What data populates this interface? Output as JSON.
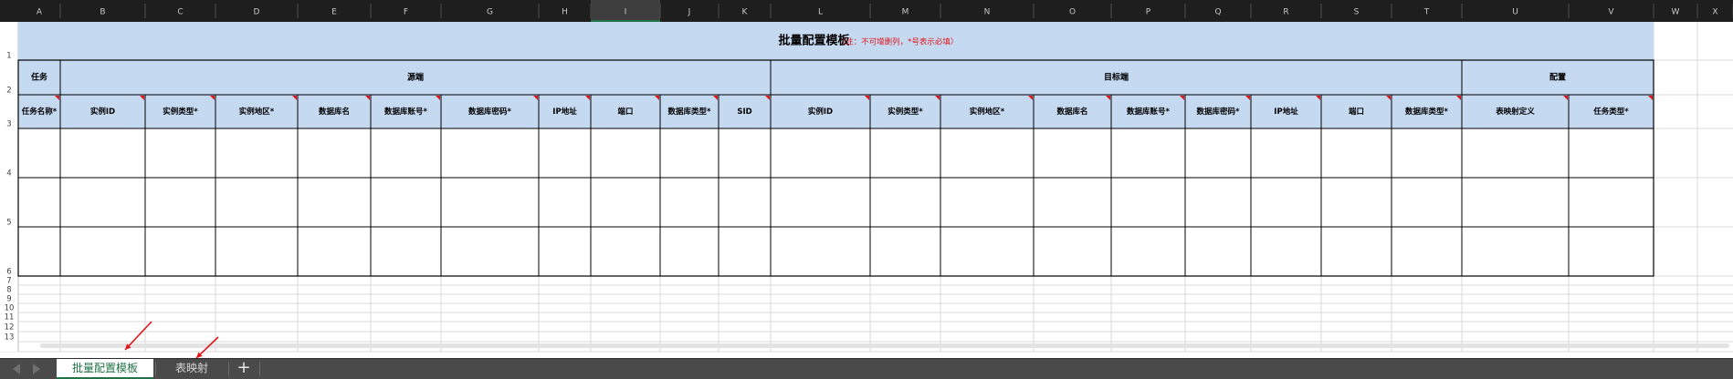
{
  "sheet": {
    "column_letters": [
      "A",
      "B",
      "C",
      "D",
      "E",
      "F",
      "G",
      "H",
      "I",
      "J",
      "K",
      "L",
      "M",
      "N",
      "O",
      "P",
      "Q",
      "R",
      "S",
      "T",
      "U",
      "V",
      "W",
      "X"
    ],
    "selected_column": "I",
    "row_numbers": [
      "1",
      "2",
      "3",
      "4",
      "5",
      "6",
      "7",
      "8",
      "9",
      "10",
      "11",
      "12",
      "13"
    ],
    "title": "批量配置模板",
    "note": "（注：不可增删列，*号表示必填）",
    "groups": {
      "task": "任务",
      "source": "源端",
      "target": "目标端",
      "config": "配置"
    },
    "source_headers": [
      "实例ID",
      "实例类型*",
      "实例地区*",
      "数据库名",
      "数据库账号*",
      "数据库密码*",
      "IP地址",
      "端口",
      "数据库类型*",
      "SID"
    ],
    "target_headers": [
      "实例ID",
      "实例类型*",
      "实例地区*",
      "数据库名",
      "数据库账号*",
      "数据库密码*",
      "IP地址",
      "端口",
      "数据库类型*"
    ],
    "config_headers": [
      "表映射定义",
      "任务类型*"
    ],
    "task_header": "任务名称*",
    "empty_data_rows": 3
  },
  "tabs": {
    "active": "批量配置模板",
    "second": "表映射",
    "add": "+"
  },
  "colors": {
    "header_fill": "#c5d9f1",
    "column_header_bg": "#1e1e1e",
    "note_red": "#e0161b",
    "arrow_red": "#e0161b",
    "active_tab_text": "#217346"
  }
}
